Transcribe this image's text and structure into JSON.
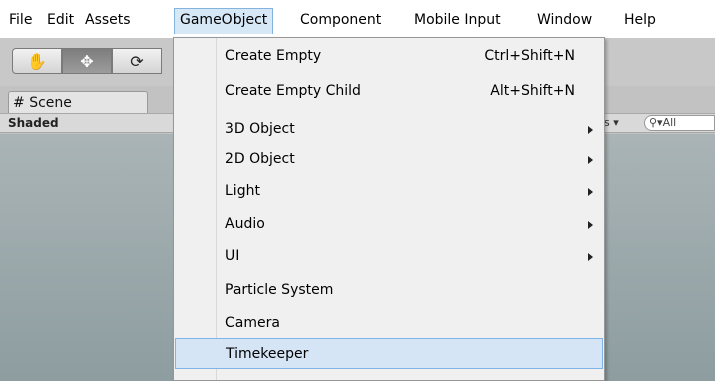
{
  "menubar": {
    "items": [
      {
        "label": "File"
      },
      {
        "label": "Edit"
      },
      {
        "label": "Assets"
      },
      {
        "label": "GameObject"
      },
      {
        "label": "Component"
      },
      {
        "label": "Mobile Input"
      },
      {
        "label": "Window"
      },
      {
        "label": "Help"
      }
    ],
    "active_item": "GameObject"
  },
  "toolbar": {
    "tools": [
      "hand-tool",
      "move-tool",
      "rotate-tool"
    ]
  },
  "scene": {
    "tab_label": "Scene",
    "tab_icon": "#",
    "shading_label": "Shaded",
    "gizmos_label": "s",
    "search_placeholder": "All"
  },
  "dropdown": {
    "items": [
      {
        "label": "Create Empty",
        "shortcut": "Ctrl+Shift+N",
        "submenu": false
      },
      {
        "label": "Create Empty Child",
        "shortcut": "Alt+Shift+N",
        "submenu": false
      },
      {
        "label": "3D Object",
        "shortcut": "",
        "submenu": true
      },
      {
        "label": "2D Object",
        "shortcut": "",
        "submenu": true
      },
      {
        "label": "Light",
        "shortcut": "",
        "submenu": true
      },
      {
        "label": "Audio",
        "shortcut": "",
        "submenu": true
      },
      {
        "label": "UI",
        "shortcut": "",
        "submenu": true
      },
      {
        "label": "Particle System",
        "shortcut": "",
        "submenu": false
      },
      {
        "label": "Camera",
        "shortcut": "",
        "submenu": false
      },
      {
        "label": "Timekeeper",
        "shortcut": "",
        "submenu": false
      }
    ],
    "highlighted_item": "Timekeeper"
  },
  "colors": {
    "menu_highlight": "#d5e5f5",
    "menu_highlight_border": "#7eb4ea",
    "active_menu_tab": "#d6e7f6"
  }
}
